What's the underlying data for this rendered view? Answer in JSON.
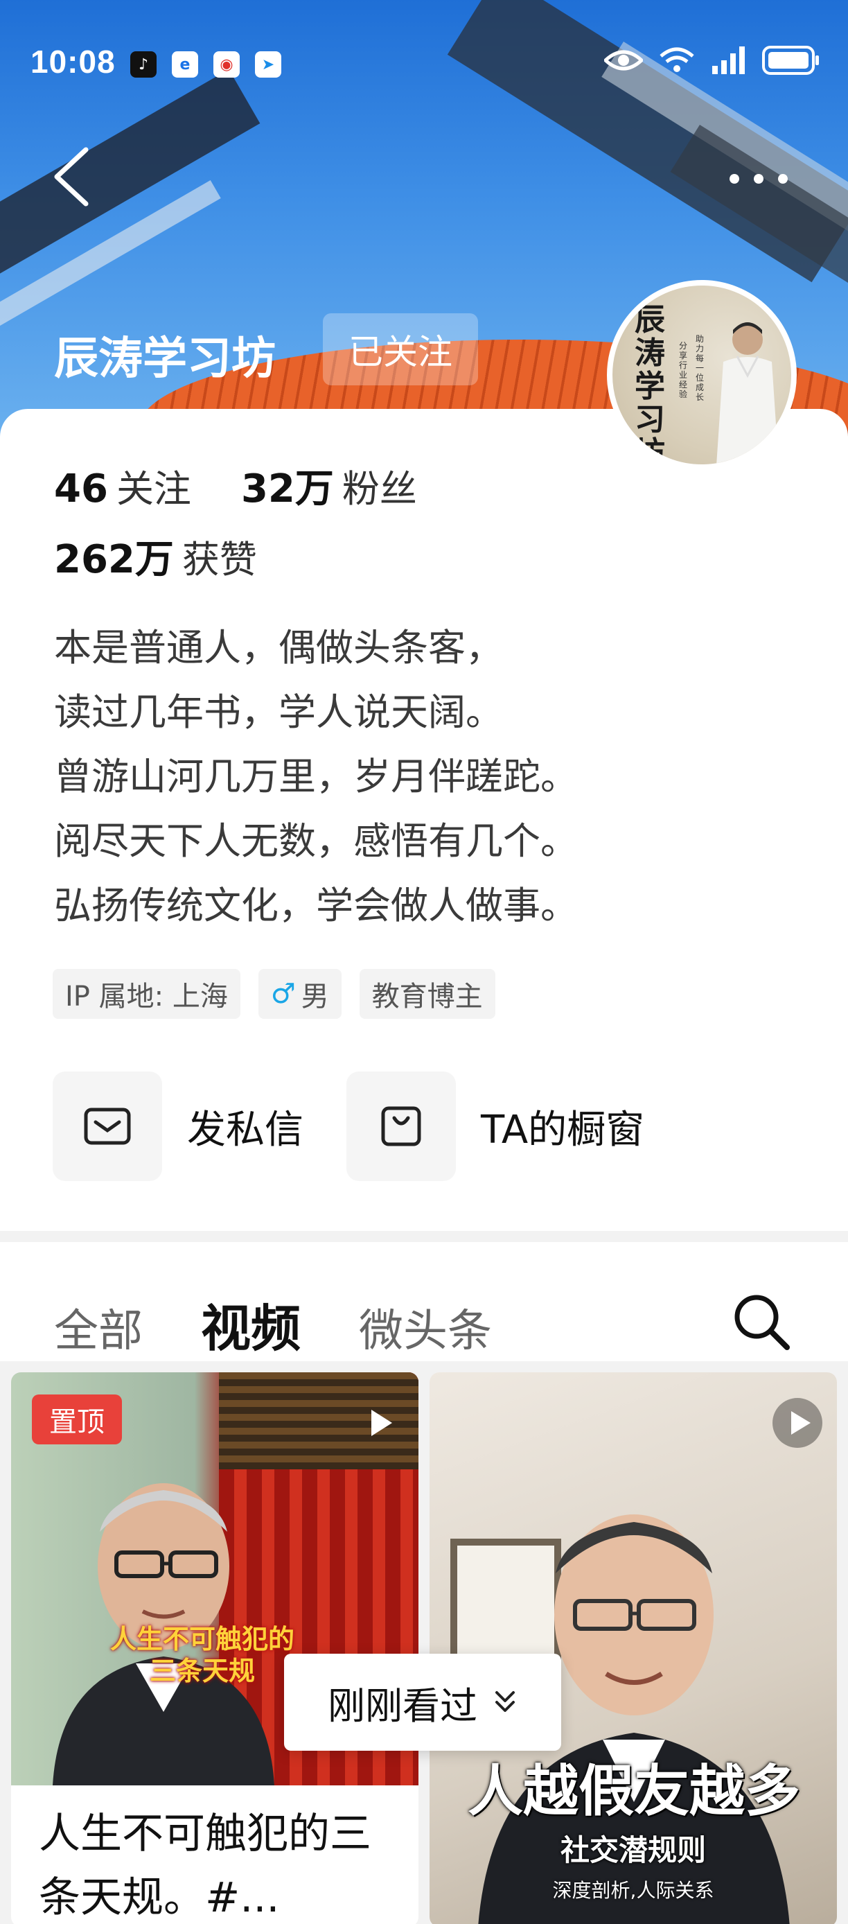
{
  "status_bar": {
    "time": "10:08",
    "apps": [
      "tiktok-icon",
      "browser-icon",
      "weibo-icon",
      "compass-icon"
    ],
    "right_icons": [
      "eye-icon",
      "wifi-icon",
      "signal-icon",
      "battery-icon"
    ]
  },
  "header": {
    "name": "辰涛学习坊",
    "follow_state": "已关注",
    "avatar_text": "辰涛学习坊",
    "avatar_tag1": "分享行业经验",
    "avatar_tag2": "助力每一位成长"
  },
  "stats": {
    "following_count": "46",
    "following_label": "关注",
    "fans_count": "32万",
    "fans_label": "粉丝",
    "likes_count": "262万",
    "likes_label": "获赞"
  },
  "bio": [
    "本是普通人，偶做头条客，",
    "读过几年书，学人说天阔。",
    "曾游山河几万里，岁月伴蹉跎。",
    "阅尽天下人无数，感悟有几个。",
    "弘扬传统文化，学会做人做事。"
  ],
  "tags": {
    "ip": "IP 属地: 上海",
    "gender": "男",
    "category": "教育博主"
  },
  "actions": {
    "message": "发私信",
    "shop": "TA的橱窗"
  },
  "tabs": {
    "all": "全部",
    "video": "视频",
    "micro": "微头条",
    "active": "视频"
  },
  "videos": [
    {
      "pinned_label": "置顶",
      "overlay_caption": "人生不可触犯的三条天规",
      "title": "人生不可触犯的三条天规。#..."
    },
    {
      "big_text": "人越假友越多",
      "sub_text": "社交潜规则",
      "sub_text2": "深度剖析,人际关系"
    }
  ],
  "recent_pill": "刚刚看过",
  "colors": {
    "pin_badge": "#e8413a",
    "gender_icon": "#1aa6e6",
    "caption": "#ffd23a"
  }
}
